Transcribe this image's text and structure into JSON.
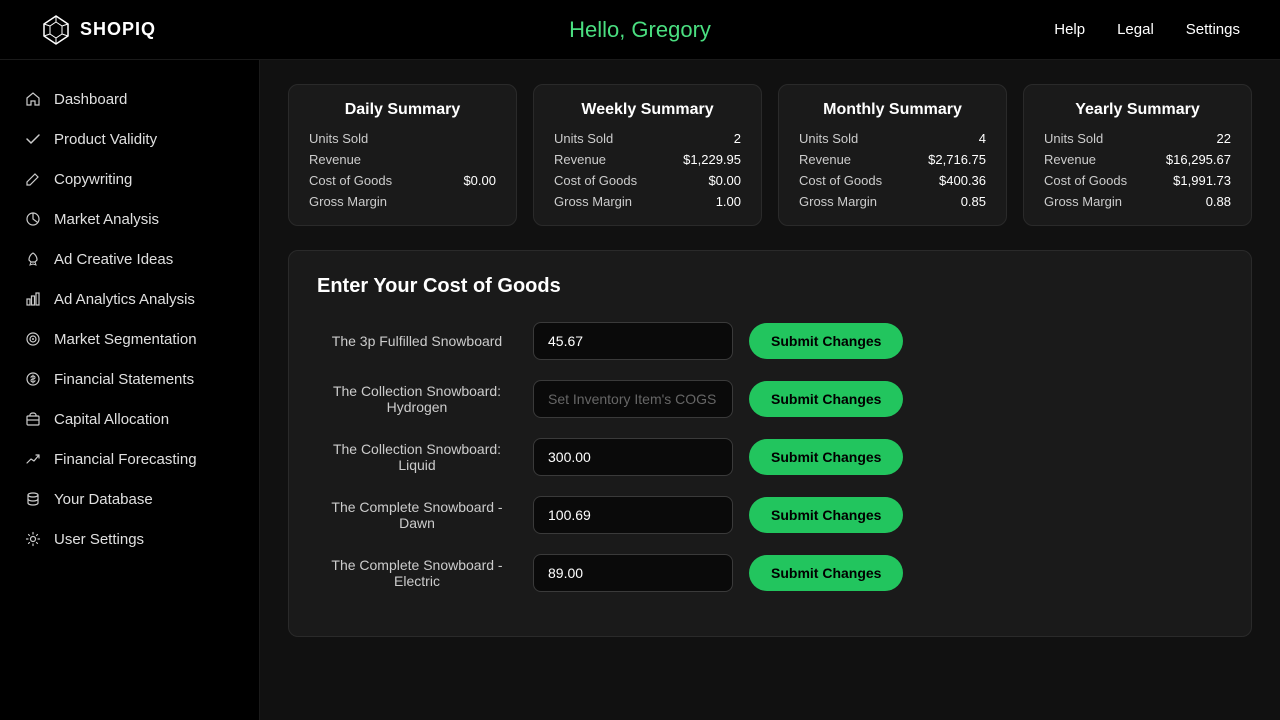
{
  "app": {
    "logo_text": "SHOPIQ",
    "greeting": "Hello, Gregory"
  },
  "header_nav": {
    "help": "Help",
    "legal": "Legal",
    "settings": "Settings"
  },
  "sidebar": {
    "items": [
      {
        "id": "dashboard",
        "label": "Dashboard",
        "icon": "home"
      },
      {
        "id": "product-validity",
        "label": "Product Validity",
        "icon": "check"
      },
      {
        "id": "copywriting",
        "label": "Copywriting",
        "icon": "pencil"
      },
      {
        "id": "market-analysis",
        "label": "Market Analysis",
        "icon": "chart-pie"
      },
      {
        "id": "ad-creative-ideas",
        "label": "Ad Creative Ideas",
        "icon": "rocket"
      },
      {
        "id": "ad-analytics",
        "label": "Ad Analytics Analysis",
        "icon": "bar-chart"
      },
      {
        "id": "market-segmentation",
        "label": "Market Segmentation",
        "icon": "target"
      },
      {
        "id": "financial-statements",
        "label": "Financial Statements",
        "icon": "dollar"
      },
      {
        "id": "capital-allocation",
        "label": "Capital Allocation",
        "icon": "briefcase"
      },
      {
        "id": "financial-forecasting",
        "label": "Financial Forecasting",
        "icon": "trend"
      },
      {
        "id": "your-database",
        "label": "Your Database",
        "icon": "database"
      },
      {
        "id": "user-settings",
        "label": "User Settings",
        "icon": "gear"
      }
    ]
  },
  "summary_cards": [
    {
      "title": "Daily Summary",
      "units_sold_label": "Units Sold",
      "units_sold_value": "",
      "revenue_label": "Revenue",
      "revenue_value": "",
      "cog_label": "Cost of Goods",
      "cog_value": "$0.00",
      "margin_label": "Gross Margin",
      "margin_value": ""
    },
    {
      "title": "Weekly Summary",
      "units_sold_label": "Units Sold",
      "units_sold_value": "2",
      "revenue_label": "Revenue",
      "revenue_value": "$1,229.95",
      "cog_label": "Cost of Goods",
      "cog_value": "$0.00",
      "margin_label": "Gross Margin",
      "margin_value": "1.00"
    },
    {
      "title": "Monthly Summary",
      "units_sold_label": "Units Sold",
      "units_sold_value": "4",
      "revenue_label": "Revenue",
      "revenue_value": "$2,716.75",
      "cog_label": "Cost of Goods",
      "cog_value": "$400.36",
      "margin_label": "Gross Margin",
      "margin_value": "0.85"
    },
    {
      "title": "Yearly Summary",
      "units_sold_label": "Units Sold",
      "units_sold_value": "22",
      "revenue_label": "Revenue",
      "revenue_value": "$16,295.67",
      "cog_label": "Cost of Goods",
      "cog_value": "$1,991.73",
      "margin_label": "Gross Margin",
      "margin_value": "0.88"
    }
  ],
  "cog_section": {
    "title": "Enter Your Cost of Goods",
    "submit_label": "Submit Changes",
    "rows": [
      {
        "id": "3p-fulfilled",
        "label": "The 3p Fulfilled Snowboard",
        "value": "45.67",
        "placeholder": ""
      },
      {
        "id": "collection-hydrogen",
        "label": "The Collection Snowboard: Hydrogen",
        "value": "",
        "placeholder": "Set Inventory Item's COGS"
      },
      {
        "id": "collection-liquid",
        "label": "The Collection Snowboard: Liquid",
        "value": "300.00",
        "placeholder": ""
      },
      {
        "id": "complete-dawn",
        "label": "The Complete Snowboard - Dawn",
        "value": "100.69",
        "placeholder": ""
      },
      {
        "id": "complete-electric",
        "label": "The Complete Snowboard - Electric",
        "value": "89.00",
        "placeholder": ""
      }
    ]
  }
}
